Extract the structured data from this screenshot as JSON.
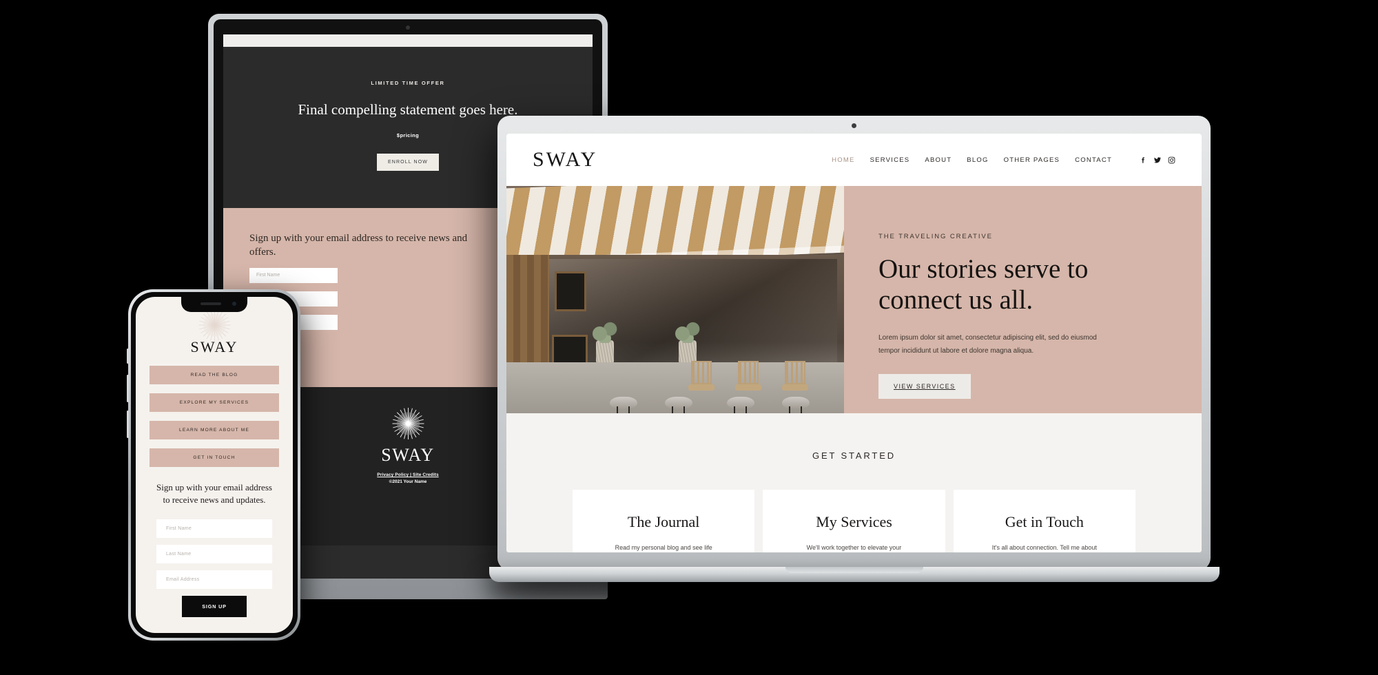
{
  "brand": "SWAY",
  "laptop": {
    "header": {
      "logo": "SWAY",
      "nav": [
        {
          "label": "HOME",
          "active": true
        },
        {
          "label": "SERVICES",
          "active": false
        },
        {
          "label": "ABOUT",
          "active": false
        },
        {
          "label": "BLOG",
          "active": false
        },
        {
          "label": "OTHER PAGES",
          "active": false
        },
        {
          "label": "CONTACT",
          "active": false
        }
      ],
      "socials": [
        "facebook-icon",
        "twitter-icon",
        "instagram-icon"
      ]
    },
    "hero": {
      "kicker": "THE TRAVELING CREATIVE",
      "heading_line1": "Our stories serve to",
      "heading_line2": "connect us all.",
      "paragraph": "Lorem ipsum dolor sit amet, consectetur adipiscing elit, sed do eiusmod tempor incididunt ut labore et dolore magna aliqua.",
      "button": "VIEW SERVICES",
      "background_color": "#d6b6aa"
    },
    "get_started": {
      "title": "GET STARTED",
      "cards": [
        {
          "title": "The Journal",
          "text": "Read my personal blog and see life"
        },
        {
          "title": "My Services",
          "text": "We'll work together to elevate your"
        },
        {
          "title": "Get in Touch",
          "text": "It's all about connection. Tell me about"
        }
      ]
    }
  },
  "tablet": {
    "cta": {
      "kicker": "LIMITED TIME OFFER",
      "heading": "Final compelling statement goes here.",
      "price": "$pricing",
      "button": "ENROLL NOW"
    },
    "signup": {
      "heading": "Sign up with your email address to receive news and offers.",
      "fields": [
        {
          "placeholder": "First Name"
        },
        {
          "placeholder": "Last Name"
        },
        {
          "placeholder": "Email Address"
        }
      ]
    },
    "footer": {
      "logo": "SWAY",
      "links": [
        "Privacy Policy",
        "Site Credits"
      ],
      "separator": " | ",
      "copyright": "©2021 Your Name"
    }
  },
  "phone": {
    "logo": "SWAY",
    "buttons": [
      {
        "label": "READ THE BLOG"
      },
      {
        "label": "EXPLORE MY SERVICES"
      },
      {
        "label": "LEARN MORE ABOUT ME"
      },
      {
        "label": "GET IN TOUCH"
      }
    ],
    "signup": {
      "heading": "Sign up with your email address to receive news and updates.",
      "fields": [
        {
          "placeholder": "First Name"
        },
        {
          "placeholder": "Last Name"
        },
        {
          "placeholder": "Email Address"
        }
      ],
      "submit": "SIGN UP"
    }
  },
  "colors": {
    "accent_pink": "#d6b6aa",
    "dark": "#2b2b2b",
    "page_bg": "#f5f3f1",
    "nav_active": "#a79387",
    "background": "#000000"
  }
}
